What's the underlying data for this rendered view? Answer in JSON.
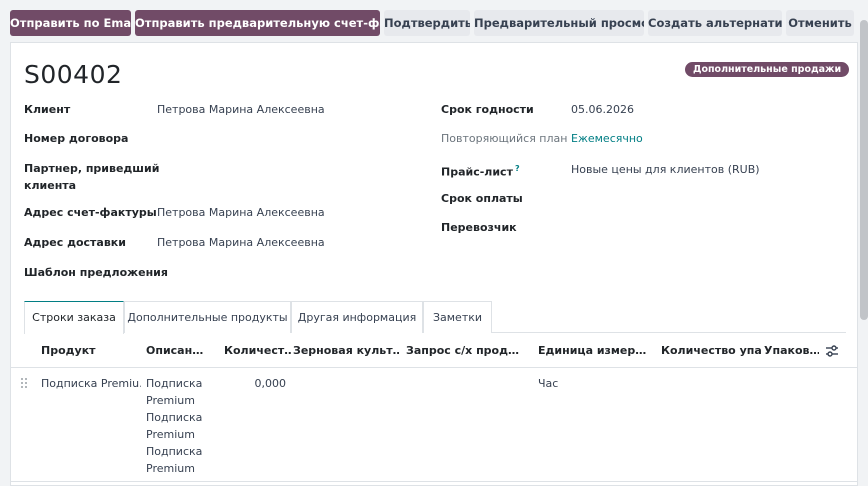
{
  "toolbar": {
    "send_email": "Отправить по Email",
    "send_proforma": "Отправить предварительную счет-фактуру",
    "confirm": "Подтвердить",
    "preview": "Предварительный просмотр",
    "create_alternative": "Создать альтернативу",
    "cancel": "Отменить"
  },
  "record": {
    "name": "S00402",
    "badge": "Дополнительные продажи"
  },
  "left_fields": {
    "customer_label": "Клиент",
    "customer_value": "Петрова  Марина Алексеевна",
    "contract_label": "Номер договора",
    "referrer_label_1": "Партнер, приведший",
    "referrer_label_2": "клиента",
    "invoice_address_label": "Адрес счет-фактуры",
    "invoice_address_value": "Петрова  Марина Алексеевна",
    "delivery_address_label": "Адрес доставки",
    "delivery_address_value": "Петрова  Марина Алексеевна",
    "template_label": "Шаблон предложения"
  },
  "right_fields": {
    "expiration_label": "Срок годности",
    "expiration_value": "05.06.2026",
    "recurring_label": "Повторяющийся план",
    "recurring_value": "Ежемесячно",
    "pricelist_label": "Прайс-лист",
    "pricelist_help": "?",
    "pricelist_value": "Новые цены для клиентов (RUB)",
    "payment_terms_label": "Срок оплаты",
    "carrier_label": "Перевозчик"
  },
  "tabs": [
    "Строки заказа",
    "Дополнительные продукты",
    "Другая информация",
    "Заметки"
  ],
  "table": {
    "columns": [
      "Продукт",
      "Описан…",
      "Количест…",
      "Зерновая культ…",
      "Запрос с/х прод…",
      "Единица измер…",
      "Количество упа…",
      "Упаков…"
    ],
    "row": {
      "product": "Подписка Premiu…",
      "description": [
        "Подписка",
        "Premium",
        "Подписка",
        "Premium",
        "Подписка",
        "Premium"
      ],
      "quantity": "0,000",
      "uom": "Час"
    }
  },
  "colors": {
    "primary": "#714b67",
    "link": "#017e84"
  }
}
